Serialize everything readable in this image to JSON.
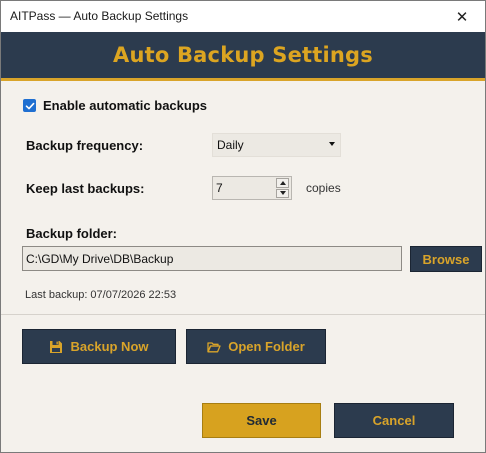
{
  "window": {
    "title": "AITPass — Auto Backup Settings",
    "close_glyph": "✕"
  },
  "header": {
    "title": "Auto Backup Settings",
    "bg_color": "#2c3b4e",
    "accent_color": "#d9a42a"
  },
  "settings": {
    "enable_label": "Enable automatic backups",
    "enable_checked": true,
    "frequency_label": "Backup frequency:",
    "frequency_value": "Daily",
    "keep_label": "Keep last backups:",
    "keep_value": "7",
    "keep_unit": "copies",
    "folder_label": "Backup folder:",
    "folder_path": "C:\\GD\\My Drive\\DB\\Backup",
    "browse_label": "Browse",
    "last_backup_text": "Last backup:  07/07/2026 22:53"
  },
  "actions": {
    "backup_now_label": "Backup Now",
    "backup_now_icon": "floppy-disk-icon",
    "open_folder_label": "Open Folder",
    "open_folder_icon": "folder-open-icon"
  },
  "footer": {
    "save_label": "Save",
    "cancel_label": "Cancel"
  }
}
